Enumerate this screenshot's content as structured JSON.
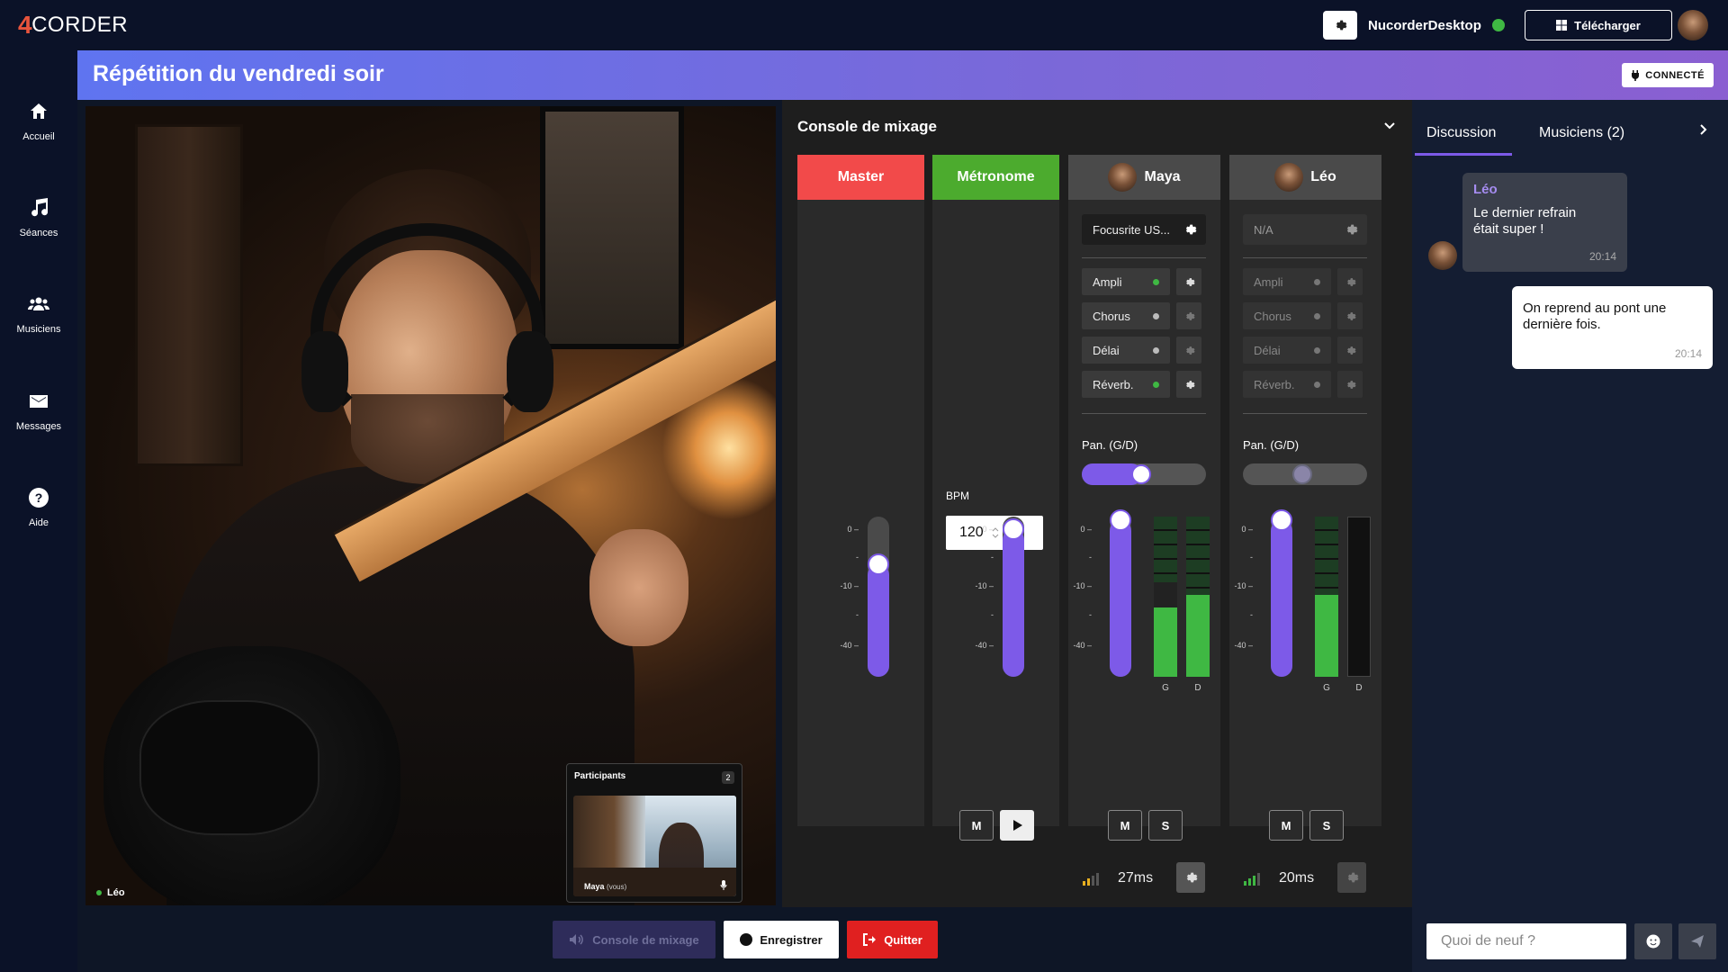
{
  "app": {
    "logo_mark": "4",
    "logo_text": "CORDER",
    "desktop_name": "NucorderDesktop",
    "download_label": "Télécharger"
  },
  "sidebar": {
    "items": [
      {
        "label": "Accueil",
        "icon": "home-icon"
      },
      {
        "label": "Séances",
        "icon": "music-note-icon"
      },
      {
        "label": "Musiciens",
        "icon": "users-icon"
      },
      {
        "label": "Messages",
        "icon": "envelope-icon"
      },
      {
        "label": "Aide",
        "icon": "help-icon"
      }
    ]
  },
  "session": {
    "title": "Répétition du vendredi soir",
    "status": "CONNECTÉ"
  },
  "video": {
    "speaker": "Léo",
    "participants_title": "Participants",
    "participants_count": "2",
    "self_name": "Maya",
    "self_tag": "(vous)"
  },
  "mixer": {
    "title": "Console de mixage",
    "scale": [
      "0 –",
      "-",
      "-10 –",
      "-",
      "-40 –"
    ],
    "master": {
      "name": "Master",
      "color": "#f24a4a",
      "fader": 0.7
    },
    "metronome": {
      "name": "Métronome",
      "color": "#4cab2e",
      "bpm_label": "BPM",
      "bpm": "120",
      "fader": 0.92
    },
    "channels": [
      {
        "name": "Maya",
        "device": "Focusrite US...",
        "effects": [
          {
            "name": "Ampli",
            "on": true
          },
          {
            "name": "Chorus",
            "on": false
          },
          {
            "name": "Délai",
            "on": false
          },
          {
            "name": "Réverb.",
            "on": true
          }
        ],
        "pan_label": "Pan. (G/D)",
        "pan": 0.4,
        "fader": 0.98,
        "meter_left": 0.43,
        "meter_right": 0.51,
        "meter_left_peak": 0.59,
        "meter_left_label": "G",
        "meter_right_label": "D",
        "mute": "M",
        "solo": "S",
        "latency": "27ms"
      },
      {
        "name": "Léo",
        "device": "N/A",
        "effects": [
          {
            "name": "Ampli",
            "on": false
          },
          {
            "name": "Chorus",
            "on": false
          },
          {
            "name": "Délai",
            "on": false
          },
          {
            "name": "Réverb.",
            "on": false
          }
        ],
        "pan_label": "Pan. (G/D)",
        "pan": 0.4,
        "fader": 0.98,
        "meter_left": 0.51,
        "meter_right": 0,
        "meter_left_label": "G",
        "meter_right_label": "D",
        "mute": "M",
        "solo": "S",
        "latency": "20ms"
      }
    ],
    "mute_label": "M"
  },
  "chat": {
    "tab_discussion": "Discussion",
    "tab_musicians": "Musiciens (2)",
    "messages": [
      {
        "author": "Léo",
        "text": "Le dernier refrain était super !",
        "time": "20:14"
      },
      {
        "author": "",
        "text": "On reprend au pont une dernière fois.",
        "time": "20:14"
      }
    ],
    "input_placeholder": "Quoi de neuf ?"
  },
  "bottom": {
    "mixer_button": "Console de mixage",
    "record_button": "Enregistrer",
    "quit_button": "Quitter"
  },
  "colors": {
    "accent": "#7d5ae8",
    "online": "#3fb843",
    "danger": "#e02020"
  }
}
